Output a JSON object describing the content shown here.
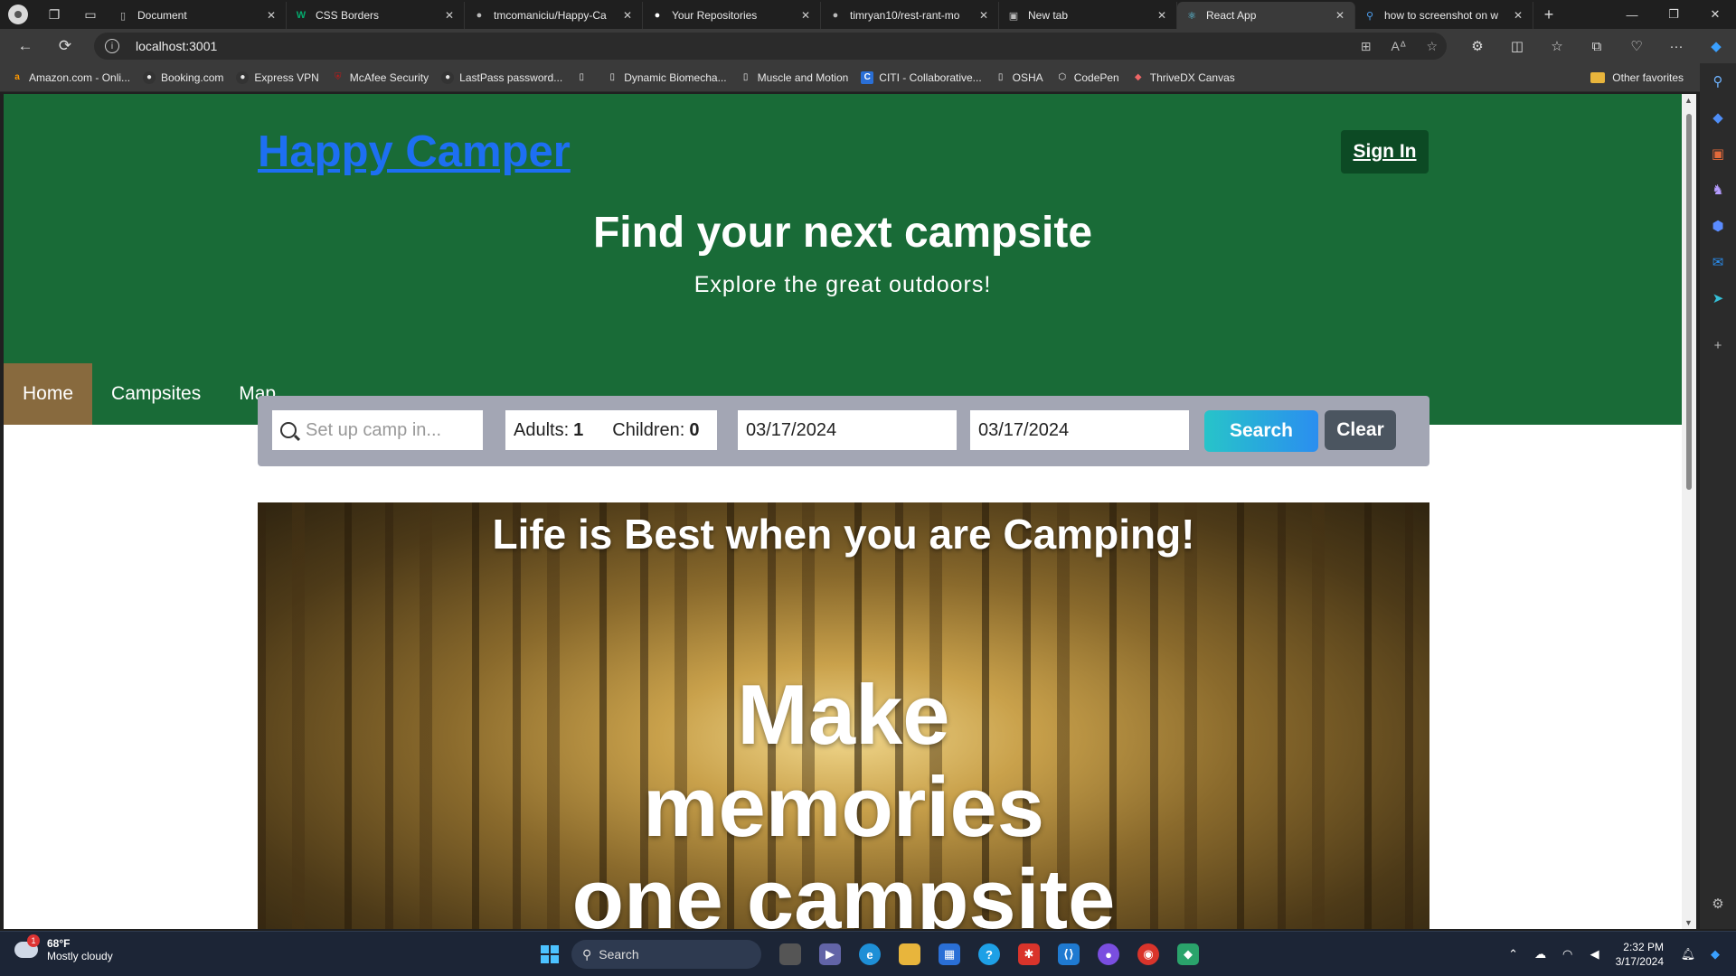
{
  "browser": {
    "tabs": [
      {
        "title": "Document",
        "icon": "doc-icon",
        "active": false
      },
      {
        "title": "CSS Borders",
        "icon": "w3schools-icon",
        "active": false
      },
      {
        "title": "tmcomaniciu/Happy-Ca",
        "icon": "github-icon",
        "active": false
      },
      {
        "title": "Your Repositories",
        "icon": "github-icon",
        "active": false
      },
      {
        "title": "timryan10/rest-rant-mo",
        "icon": "github-icon",
        "active": false
      },
      {
        "title": "New tab",
        "icon": "newtab-icon",
        "active": false
      },
      {
        "title": "React App",
        "icon": "react-icon",
        "active": true
      },
      {
        "title": "how to screenshot on w",
        "icon": "bing-search-icon",
        "active": false
      }
    ],
    "url": "localhost:3001",
    "favorites": [
      {
        "label": "Amazon.com - Onli...",
        "icon": "amazon-icon",
        "color": "#ff9900"
      },
      {
        "label": "Booking.com",
        "icon": "booking-icon",
        "color": "#ddd"
      },
      {
        "label": "Express VPN",
        "icon": "vpn-icon",
        "color": "#ddd"
      },
      {
        "label": "McAfee Security",
        "icon": "mcafee-icon",
        "color": "#c01818"
      },
      {
        "label": "LastPass password...",
        "icon": "lastpass-icon",
        "color": "#ddd"
      },
      {
        "label": "",
        "icon": "doc-icon",
        "color": "#ddd"
      },
      {
        "label": "Dynamic Biomecha...",
        "icon": "doc-icon",
        "color": "#ddd"
      },
      {
        "label": "Muscle and Motion",
        "icon": "doc-icon",
        "color": "#ddd"
      },
      {
        "label": "CITI - Collaborative...",
        "icon": "citi-icon",
        "color": "#2a6fd6"
      },
      {
        "label": "OSHA",
        "icon": "doc-icon",
        "color": "#ddd"
      },
      {
        "label": "CodePen",
        "icon": "codepen-icon",
        "color": "#ddd"
      },
      {
        "label": "ThriveDX Canvas",
        "icon": "canvas-icon",
        "color": "#e66"
      }
    ],
    "other_favorites": "Other favorites"
  },
  "page": {
    "brand": "Happy Camper",
    "sign_in": "Sign In",
    "headline": "Find your next campsite",
    "subheadline": "Explore the great outdoors!",
    "nav": [
      {
        "label": "Home",
        "active": true
      },
      {
        "label": "Campsites",
        "active": false
      },
      {
        "label": "Map",
        "active": false
      }
    ],
    "search": {
      "location_placeholder": "Set up camp in...",
      "adults_label": "Adults:",
      "adults_value": "1",
      "children_label": "Children:",
      "children_value": "0",
      "check_in": "03/17/2024",
      "check_out": "03/17/2024",
      "search_button": "Search",
      "clear_button": "Clear"
    },
    "banner": {
      "tagline": "Life is Best when you are Camping!",
      "big_text_lines": [
        "Make",
        "memories",
        "one campsite"
      ]
    }
  },
  "taskbar": {
    "weather_temp": "68°F",
    "weather_desc": "Mostly cloudy",
    "weather_badge": "1",
    "search_label": "Search",
    "time": "2:32 PM",
    "date": "3/17/2024"
  },
  "colors": {
    "hero_green": "#196b37",
    "brand_link": "#1d6ff2",
    "nav_active": "#886a3e",
    "search_panel": "#a3a6b4",
    "clear_button": "#4b5560"
  }
}
